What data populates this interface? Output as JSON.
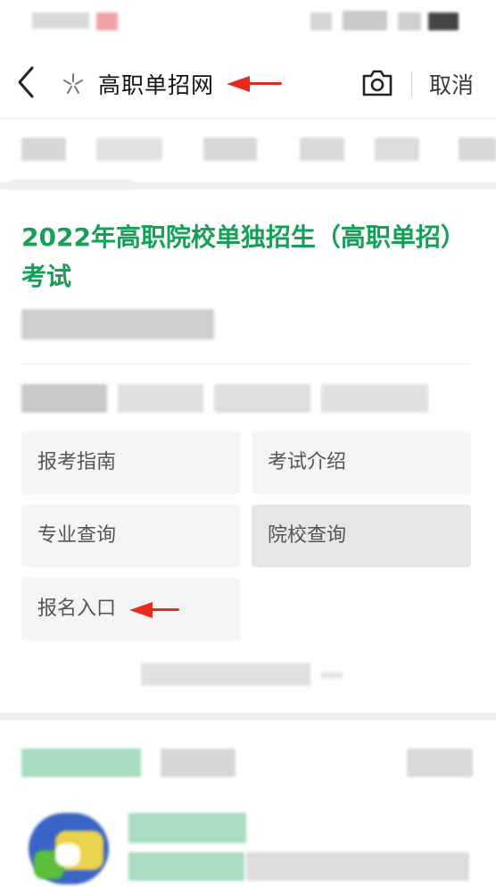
{
  "header": {
    "search_query": "高职单招网",
    "cancel_label": "取消"
  },
  "result": {
    "title": "2022年高职院校单独招生（高职单招）考试",
    "links": [
      {
        "label": "报考指南"
      },
      {
        "label": "考试介绍"
      },
      {
        "label": "专业查询"
      },
      {
        "label": "院校查询"
      },
      {
        "label": "报名入口"
      }
    ]
  },
  "colors": {
    "title_green": "#15a058",
    "arrow_red": "#e8291c"
  },
  "icons": [
    "back-icon",
    "star-icon",
    "camera-icon"
  ]
}
